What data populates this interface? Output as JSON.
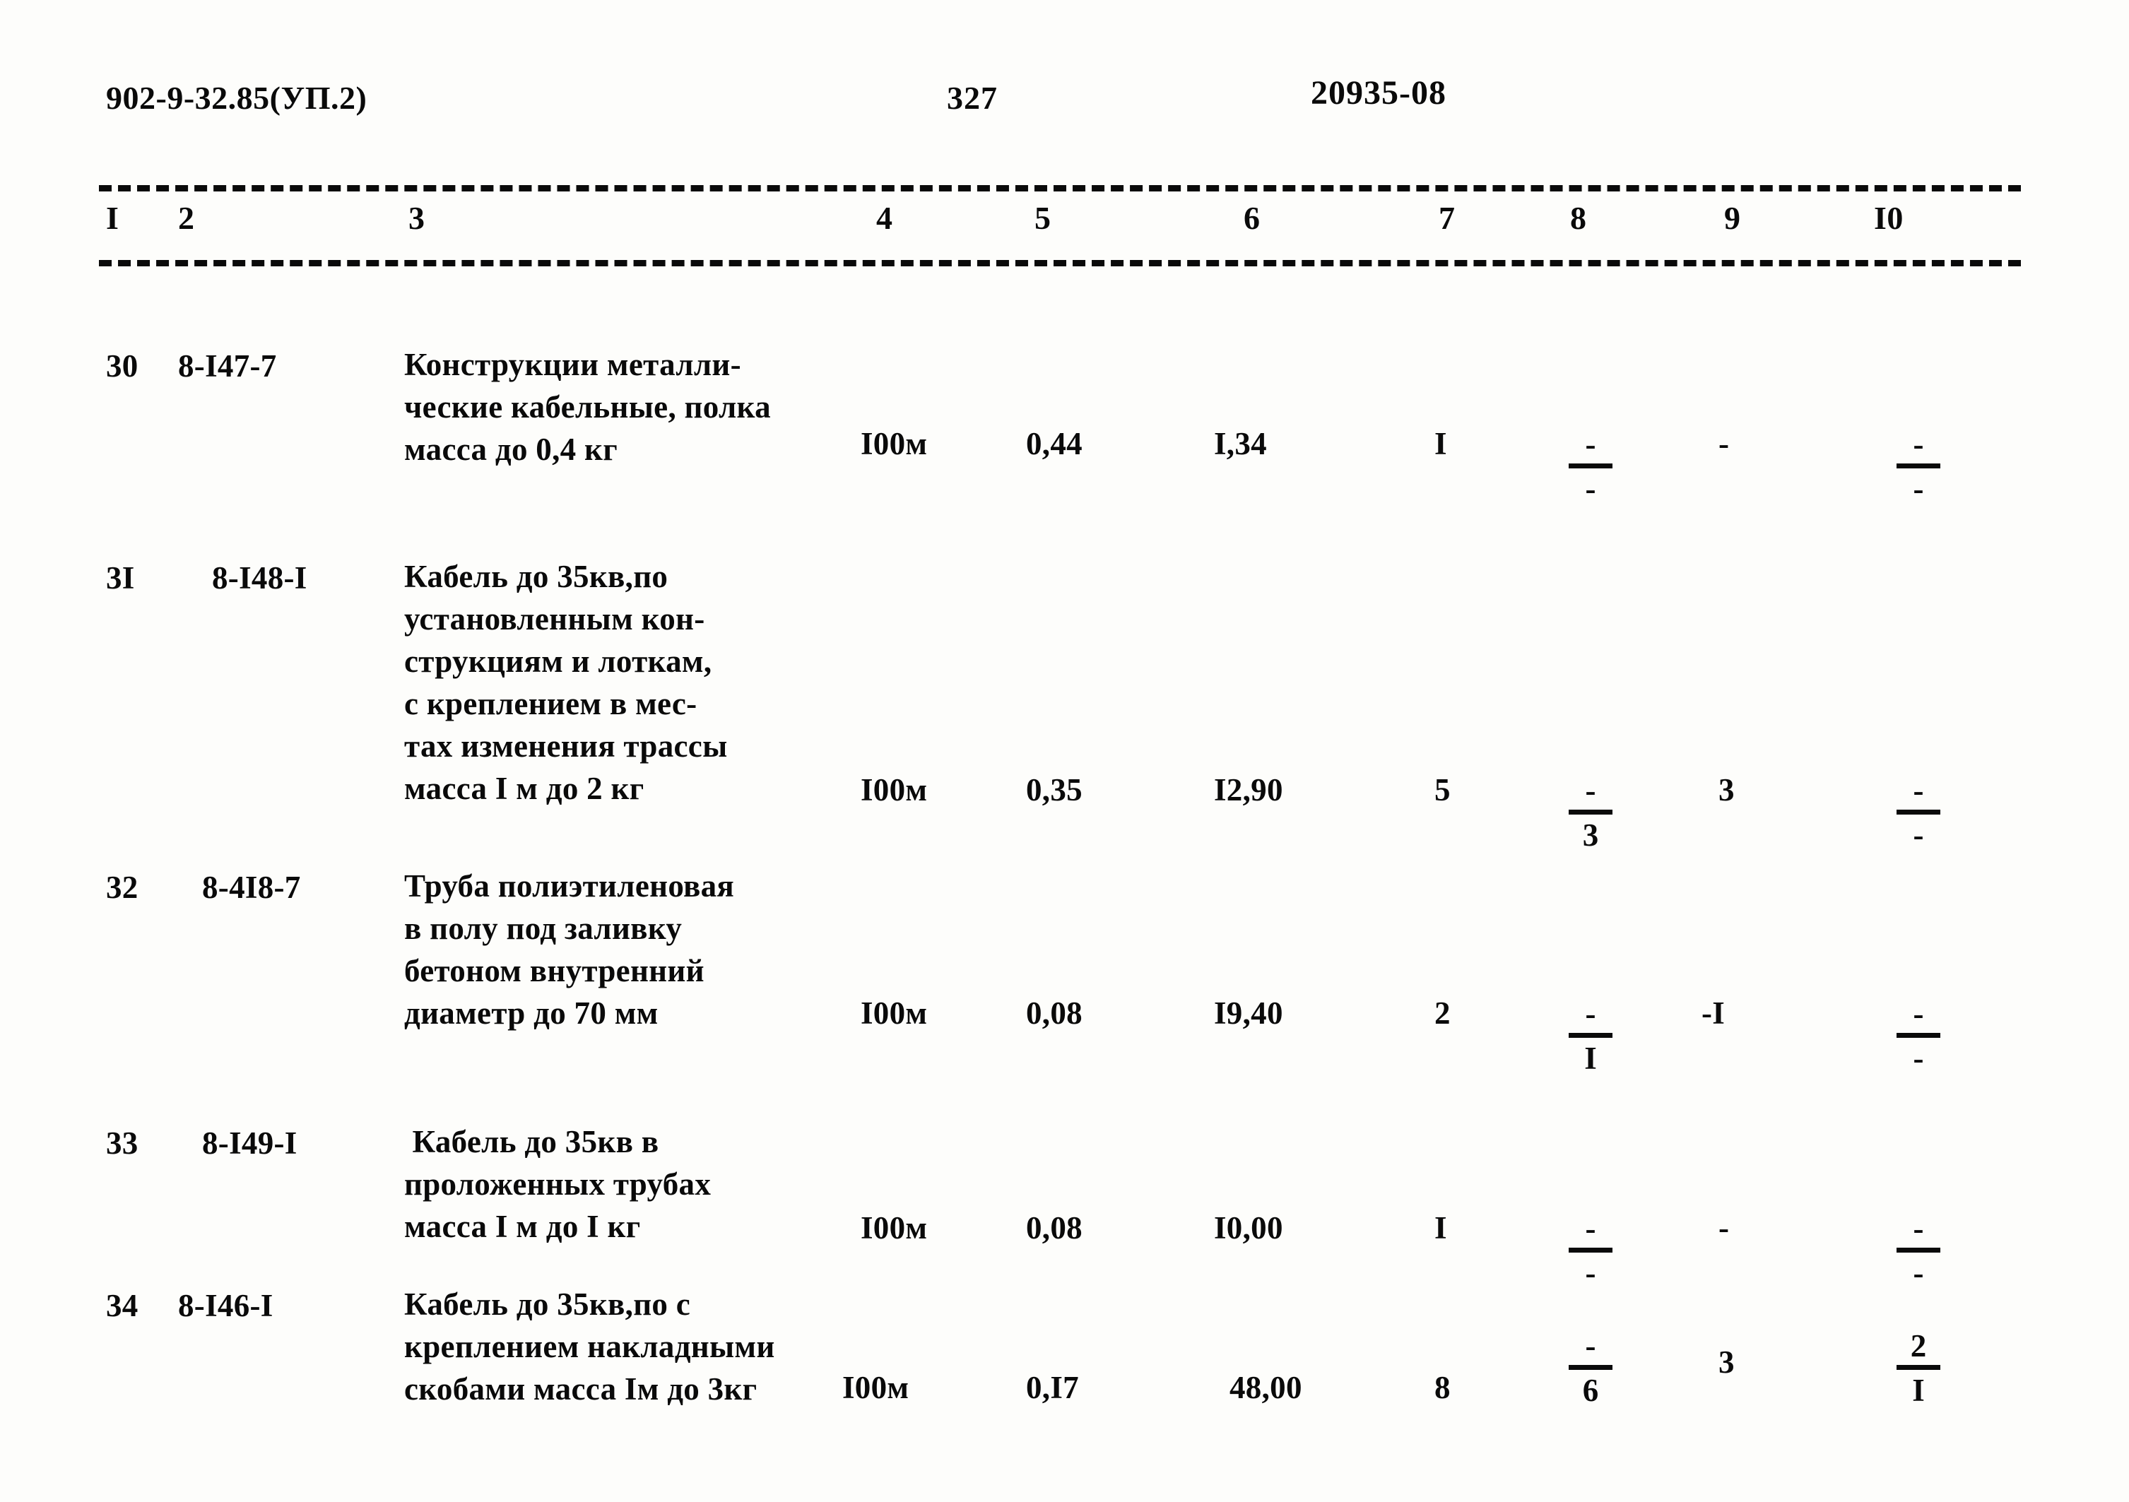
{
  "header": {
    "doc_code": "902-9-32.85(УП.2)",
    "page_number": "327",
    "doc_number": "20935-08"
  },
  "table": {
    "column_headers": [
      "I",
      "2",
      "3",
      "4",
      "5",
      "6",
      "7",
      "8",
      "9",
      "I0"
    ],
    "rows": [
      {
        "num": "30",
        "code": "8-I47-7",
        "description": "Конструкции металли-\nческие кабельные, полка\nмасса до 0,4 кг",
        "unit": "I00м",
        "col5": "0,44",
        "col6": "I,34",
        "col7": "I",
        "col8_num": "-",
        "col8_den": "-",
        "col9": "-",
        "col10_num": "-",
        "col10_den": "-"
      },
      {
        "num": "3I",
        "code": "8-I48-I",
        "description": "Кабель до 35кв,по\nустановленным кон-\nструкциям и лоткам,\nс креплением в мес-\nтах изменения трассы\nмасса I м до 2 кг",
        "unit": "I00м",
        "col5": "0,35",
        "col6": "I2,90",
        "col7": "5",
        "col8_num": "-",
        "col8_den": "3",
        "col9": "3",
        "col10_num": "-",
        "col10_den": "-"
      },
      {
        "num": "32",
        "code": "8-4I8-7",
        "description": "Труба полиэтиленовая\nв полу под заливку\nбетоном внутренний\nдиаметр до 70 мм",
        "unit": "I00м",
        "col5": "0,08",
        "col6": "I9,40",
        "col7": "2",
        "col8_num": "-",
        "col8_den": "I",
        "col9": "-I",
        "col10_num": "-",
        "col10_den": "-"
      },
      {
        "num": "33",
        "code": "8-I49-I",
        "description": " Кабель до 35кв в\nпроложенных трубах\nмасса I м до I кг",
        "unit": "I00м",
        "col5": "0,08",
        "col6": "I0,00",
        "col7": "I",
        "col8_num": "-",
        "col8_den": "-",
        "col9": "-",
        "col10_num": "-",
        "col10_den": "-"
      },
      {
        "num": "34",
        "code": "8-I46-I",
        "description": "Кабель до 35кв,по с\nкреплением накладными\nскобами масса Iм до 3кг",
        "unit": "I00м",
        "col5": "0,I7",
        "col6": "48,00",
        "col7": "8",
        "col8_num": "-",
        "col8_den": "6",
        "col9": "3",
        "col10_num": "2",
        "col10_den": "I"
      }
    ]
  }
}
